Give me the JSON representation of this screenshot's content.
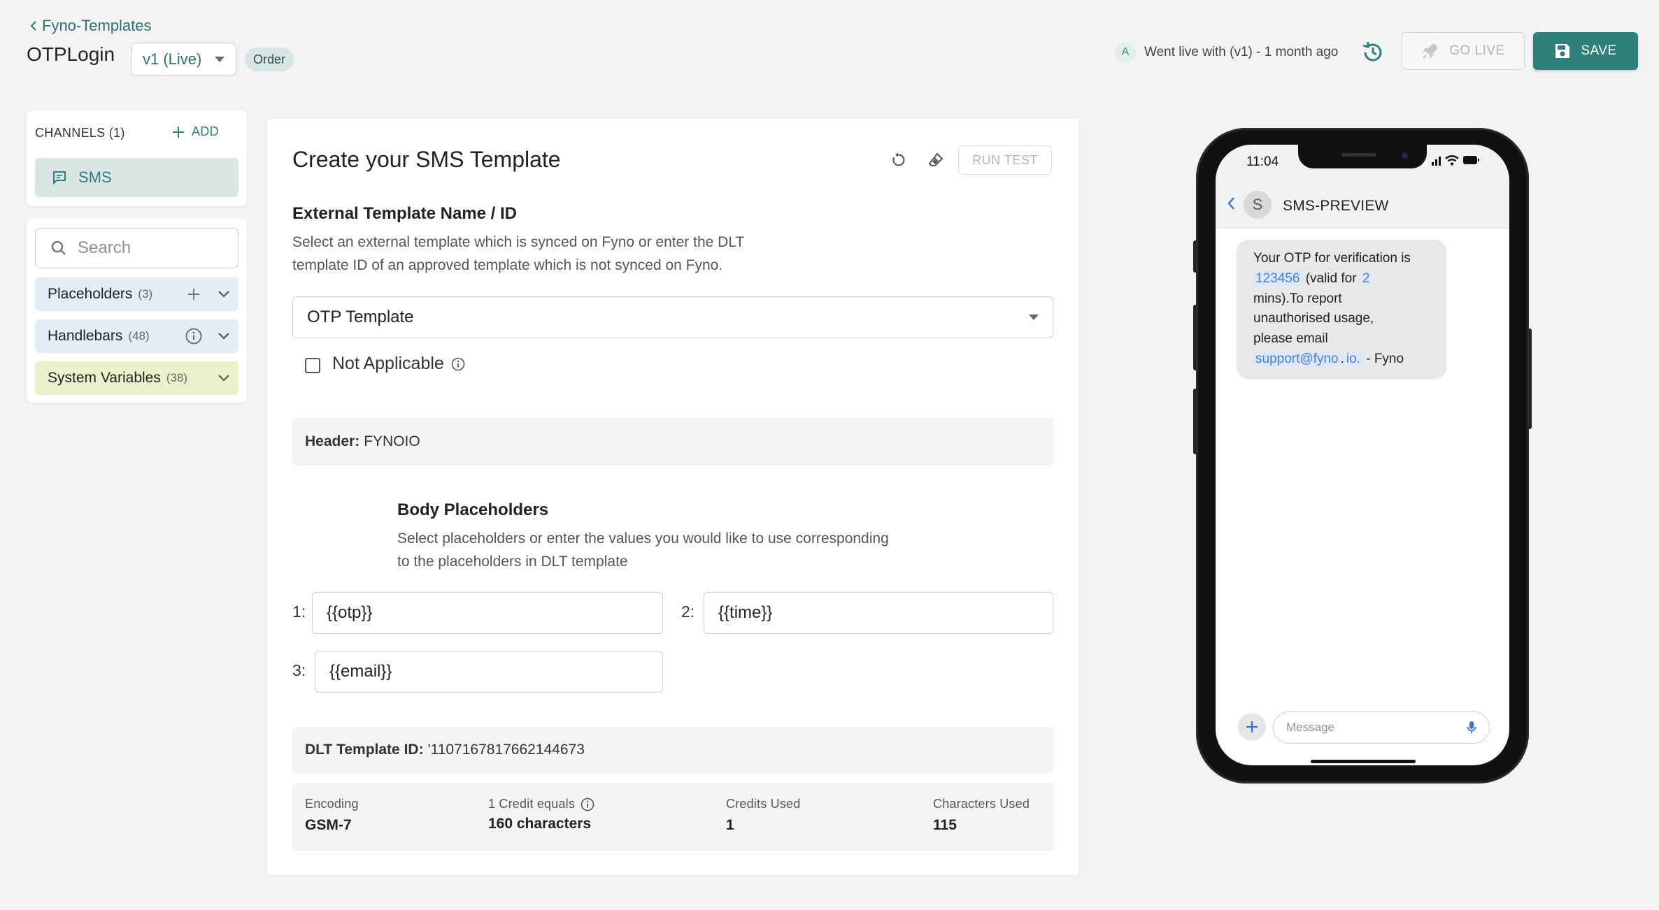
{
  "header": {
    "back_label": "Fyno-Templates",
    "template_name": "OTPLogin",
    "version": "v1 (Live)",
    "badge": "Order",
    "avatar_letter": "A",
    "live_status": "Went live with (v1) - 1 month ago",
    "go_live_label": "GO LIVE",
    "save_label": "SAVE"
  },
  "sidebar": {
    "channels_title": "CHANNELS (1)",
    "add_label": "ADD",
    "channel": "SMS",
    "search_placeholder": "Search",
    "groups": [
      {
        "label": "Placeholders",
        "count": "(3)"
      },
      {
        "label": "Handlebars",
        "count": "(48)"
      },
      {
        "label": "System Variables",
        "count": "(38)"
      }
    ]
  },
  "main": {
    "title": "Create your SMS Template",
    "run_test_label": "RUN TEST",
    "external_title": "External Template Name / ID",
    "external_desc_1": "Select an external template which is synced on Fyno or enter the DLT",
    "external_desc_2": "template ID of an approved template which is not synced on Fyno.",
    "external_value": "OTP Template",
    "not_applicable_label": "Not Applicable",
    "header_label": "Header:",
    "header_value": "FYNOIO",
    "body_title": "Body Placeholders",
    "body_desc_1": "Select placeholders or enter the values you would like to use corresponding",
    "body_desc_2": "to the placeholders in DLT template",
    "placeholders": [
      {
        "num": "1:",
        "value": "{{otp}}"
      },
      {
        "num": "2:",
        "value": "{{time}}"
      },
      {
        "num": "3:",
        "value": "{{email}}"
      }
    ],
    "dlt_label": "DLT Template ID:",
    "dlt_value": "'1107167817662144673",
    "stats": [
      {
        "label": "Encoding",
        "value": "GSM-7"
      },
      {
        "label": "1 Credit equals",
        "value": "160 characters"
      },
      {
        "label": "Credits Used",
        "value": "1"
      },
      {
        "label": "Characters Used",
        "value": "115"
      }
    ]
  },
  "preview": {
    "time": "11:04",
    "avatar_letter": "S",
    "sender": "SMS-PREVIEW",
    "msg_1": "Your OTP for verification is",
    "otp": "123456",
    "msg_2": "(valid for",
    "minutes": "2",
    "msg_3": "mins).To report",
    "msg_4": "unauthorised usage,",
    "msg_5": "please email",
    "email_1": "support@fyno",
    "email_sep": ".",
    "email_2": "io.",
    "msg_6": "- Fyno",
    "composer_placeholder": "Message"
  },
  "colors": {
    "accent": "#2f7f7a",
    "placeholder_bg": "#e4ecf6",
    "system_bg": "#eaf2cc",
    "highlight": "#4a7fd6"
  }
}
